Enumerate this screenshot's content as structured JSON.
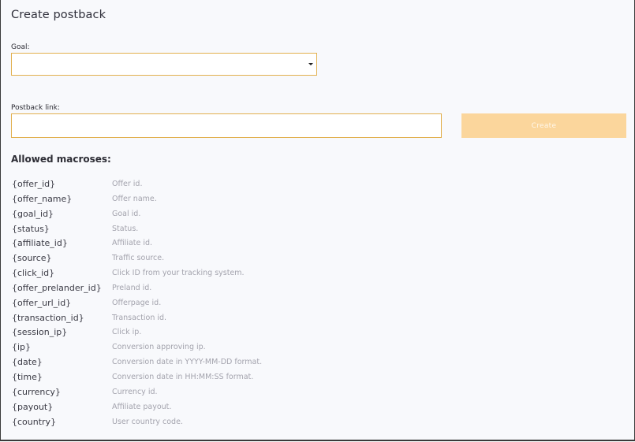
{
  "page": {
    "title": "Create postback"
  },
  "form": {
    "goal_label": "Goal:",
    "goal_value": "",
    "postback_label": "Postback link:",
    "postback_value": "",
    "create_label": "Create"
  },
  "macros": {
    "heading": "Allowed macroses:",
    "items": [
      {
        "name": "{offer_id}",
        "desc": "Offer id."
      },
      {
        "name": "{offer_name}",
        "desc": "Offer name."
      },
      {
        "name": "{goal_id}",
        "desc": "Goal id."
      },
      {
        "name": "{status}",
        "desc": "Status."
      },
      {
        "name": "{affiliate_id}",
        "desc": "Affiliate id."
      },
      {
        "name": "{source}",
        "desc": "Traffic source."
      },
      {
        "name": "{click_id}",
        "desc": "Click ID from your tracking system."
      },
      {
        "name": "{offer_prelander_id}",
        "desc": "Preland id."
      },
      {
        "name": "{offer_url_id}",
        "desc": "Offerpage id."
      },
      {
        "name": "{transaction_id}",
        "desc": "Transaction id."
      },
      {
        "name": "{session_ip}",
        "desc": "Click ip."
      },
      {
        "name": "{ip}",
        "desc": "Conversion approving ip."
      },
      {
        "name": "{date}",
        "desc": "Conversion date in YYYY-MM-DD format."
      },
      {
        "name": "{time}",
        "desc": "Conversion date in HH:MM:SS format."
      },
      {
        "name": "{currency}",
        "desc": "Currency id."
      },
      {
        "name": "{payout}",
        "desc": "Affiliate payout."
      },
      {
        "name": "{country}",
        "desc": "User country code."
      }
    ]
  },
  "colors": {
    "accent_border": "#e2b04e",
    "button_bg": "#fbd69c",
    "panel_bg": "#f8f9fc"
  }
}
